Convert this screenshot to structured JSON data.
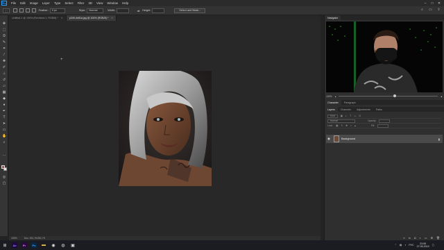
{
  "menu": [
    "File",
    "Edit",
    "Image",
    "Layer",
    "Type",
    "Select",
    "Filter",
    "3D",
    "View",
    "Window",
    "Help"
  ],
  "app_logo": "Ps",
  "options_bar": {
    "feather_label": "Feather:",
    "feather_value": "0 px",
    "style_label": "Style:",
    "style_value": "Normal",
    "width_label": "Width:",
    "height_label": "Height:",
    "select_mask_label": "Select and Mask..."
  },
  "doc_tabs": [
    {
      "label": "Untitled-1 @ 100% (Rechteck 1, RGB/8) *",
      "active": false
    },
    {
      "label": "p349-4e81a.jpg @ 100% (RGB/8) *",
      "active": true
    }
  ],
  "navigator": {
    "tab": "Navigator",
    "zoom": "100%"
  },
  "panels": {
    "char_tabs": [
      "Character",
      "Paragraph"
    ],
    "layer_tabs": [
      "Layers",
      "Channels",
      "Adjustments",
      "Paths"
    ],
    "kind_label": "Kind",
    "blend_mode": "Normal",
    "opacity_label": "Opacity:",
    "lock_label": "Lock:",
    "fill_label": "Fill:",
    "layer_name": "Background"
  },
  "status": {
    "zoom": "100%",
    "doc_info": "Doc: 251,7K/251,7K"
  },
  "tray": {
    "lang": "РУС",
    "time": "23:55",
    "date": "27.05.2019"
  },
  "colors": {
    "foreground": "#b04a43",
    "background": "#e6e6e6",
    "accent": "#31a8ff"
  }
}
